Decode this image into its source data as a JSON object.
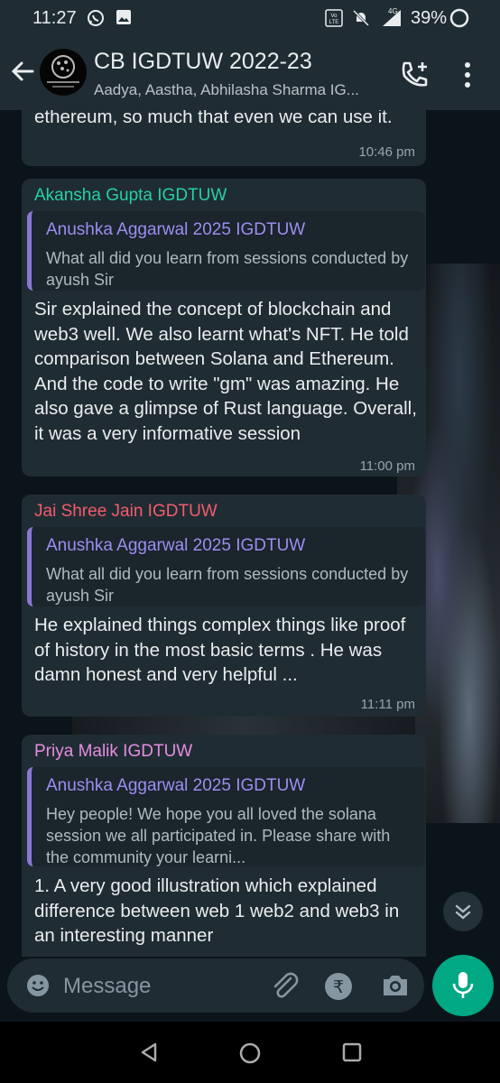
{
  "status_bar": {
    "time": "11:27",
    "battery_percent": "39%",
    "network": "4G"
  },
  "header": {
    "title": "CB IGDTUW 2022-23",
    "subtitle": "Aadya, Aastha, Abhilasha Sharma IG...",
    "avatar_text": "CELESTIAL BISCUIT IGDTUW"
  },
  "messages": [
    {
      "text": "ethereum, so much that even we can use it.",
      "time": "10:46 pm"
    },
    {
      "sender": "Akansha Gupta IGDTUW",
      "sender_color": "#25d0a4",
      "quote_author": "Anushka Aggarwal 2025 IGDTUW",
      "quote_text": "What all did you learn from sessions conducted by ayush Sir",
      "text": "Sir explained the concept of blockchain and web3 well. We also learnt what's NFT. He told comparison between Solana and Ethereum. And the code to write \"gm\" was amazing. He also gave a glimpse of Rust language. Overall, it was a very informative session",
      "time": "11:00 pm"
    },
    {
      "sender": "Jai Shree Jain IGDTUW",
      "sender_color": "#f15c6d",
      "quote_author": "Anushka Aggarwal 2025 IGDTUW",
      "quote_text": "What all did you learn from sessions conducted by ayush Sir",
      "text": "He explained things complex things like proof of history in the most basic terms . He was damn honest and very helpful ...",
      "time": "11:11 pm"
    },
    {
      "sender": "Priya Malik IGDTUW",
      "sender_color": "#e38ee0",
      "quote_author": "Anushka Aggarwal 2025 IGDTUW",
      "quote_text": "Hey people! We hope you all loved the solana session we all participated in. Please share with the community your learni...",
      "text": "1. A very good illustration which explained   difference between web 1 web2 and web3 in an interesting manner"
    }
  ],
  "composer": {
    "placeholder": "Message"
  },
  "colors": {
    "accent": "#00a884",
    "bubble": "#202c33",
    "quote_bar": "#8a77d6"
  },
  "icons": {
    "back": "arrow-left-icon",
    "call": "add-call-icon",
    "menu": "more-vert-icon",
    "emoji": "emoji-icon",
    "attach": "paperclip-icon",
    "payment": "rupee-icon",
    "camera": "camera-icon",
    "mic": "microphone-icon",
    "scroll": "double-chevron-down-icon"
  }
}
